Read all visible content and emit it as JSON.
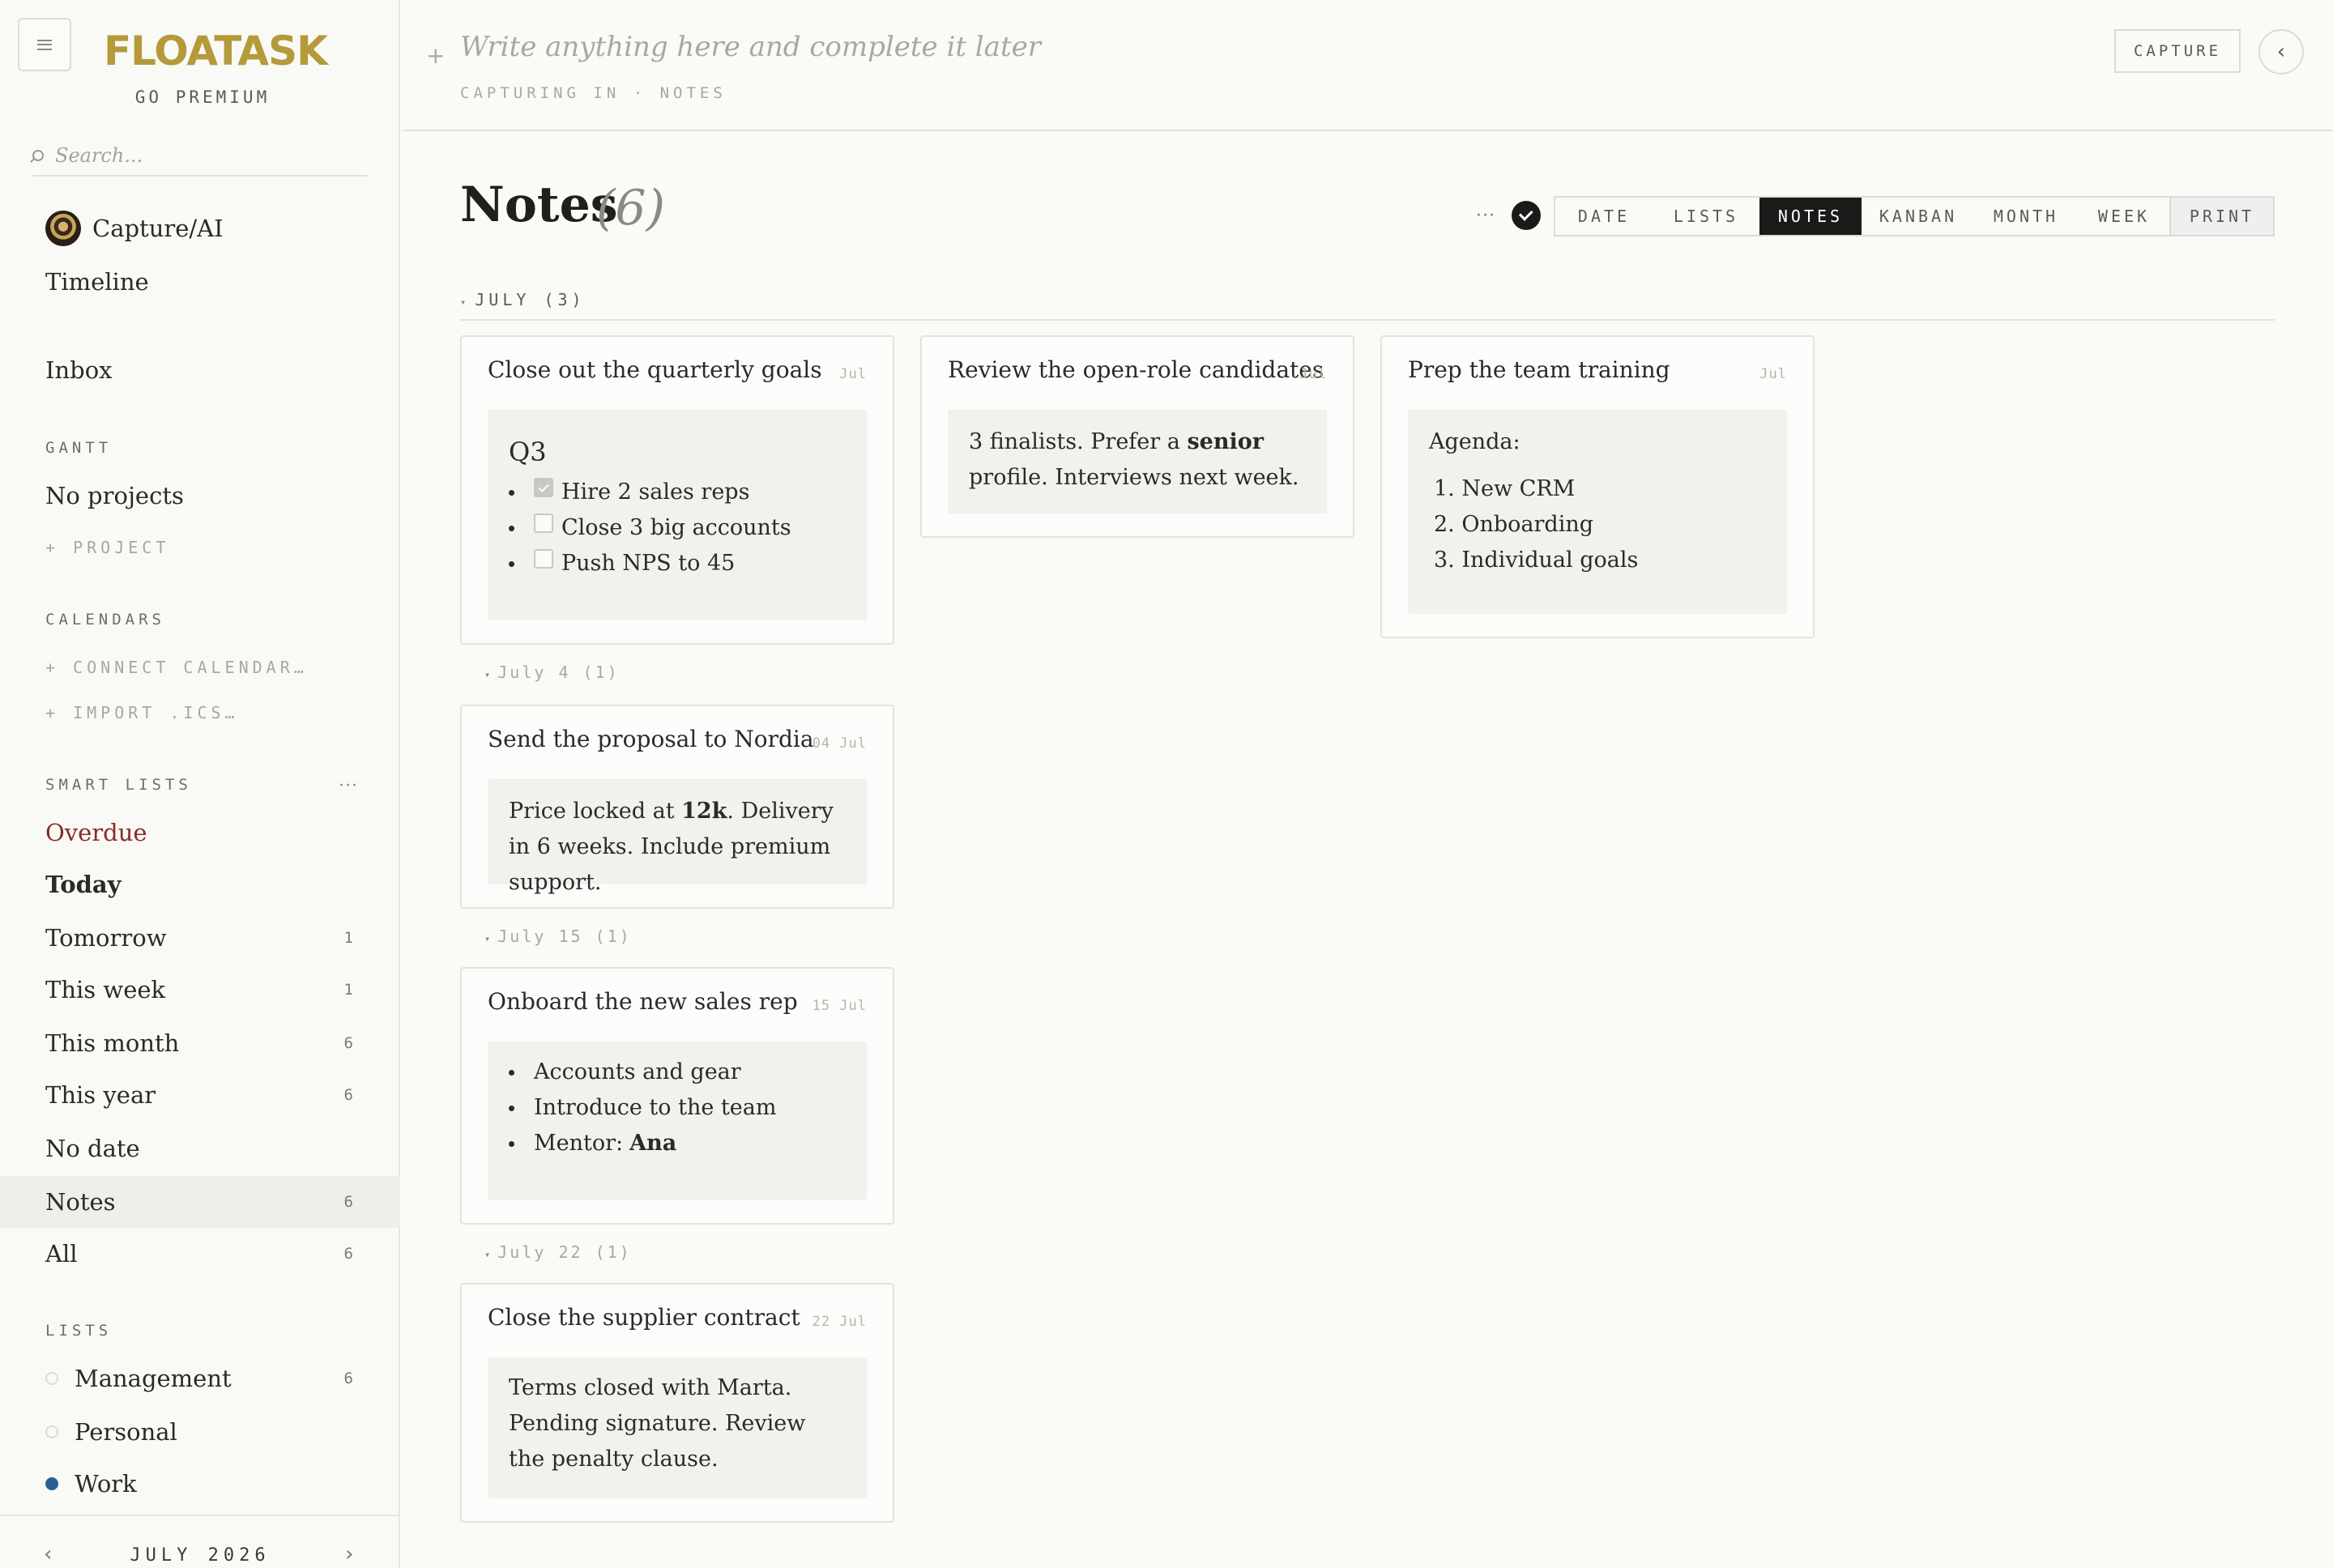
{
  "app": {
    "logo": "FLOATASK",
    "premium": "GO PREMIUM"
  },
  "sidebar": {
    "search_placeholder": "Search...",
    "top": [
      "Capture/AI",
      "Timeline",
      "Inbox"
    ],
    "gantt": {
      "heading": "GANTT",
      "empty": "No projects",
      "add": "+ PROJECT"
    },
    "calendars": {
      "heading": "CALENDARS",
      "connect": "+ CONNECT CALENDAR…",
      "import": "+ IMPORT .ICS…"
    },
    "smart_lists": {
      "heading": "SMART LISTS",
      "more": "···",
      "items": [
        {
          "label": "Overdue",
          "count": ""
        },
        {
          "label": "Today",
          "count": ""
        },
        {
          "label": "Tomorrow",
          "count": "1"
        },
        {
          "label": "This week",
          "count": "1"
        },
        {
          "label": "This month",
          "count": "6"
        },
        {
          "label": "This year",
          "count": "6"
        },
        {
          "label": "No date",
          "count": ""
        },
        {
          "label": "Notes",
          "count": "6"
        },
        {
          "label": "All",
          "count": "6"
        }
      ]
    },
    "lists": {
      "heading": "LISTS",
      "items": [
        {
          "label": "Management",
          "count": "6"
        },
        {
          "label": "Personal",
          "count": ""
        },
        {
          "label": "Work",
          "count": ""
        }
      ]
    },
    "calendar_footer": {
      "month": "JULY 2026",
      "prev": "‹",
      "next": "›"
    }
  },
  "capture": {
    "plus": "+",
    "placeholder": "Write anything here and complete it later",
    "sub": "CAPTURING IN · NOTES",
    "button": "CAPTURE",
    "collapse": "‹"
  },
  "main": {
    "title": "Notes",
    "count": "(6)",
    "more": "···",
    "view_tabs": [
      "DATE",
      "LISTS",
      "NOTES",
      "KANBAN",
      "MONTH",
      "WEEK"
    ],
    "active_view": "NOTES",
    "print": "PRINT",
    "group": {
      "caret": "▾",
      "label": "JULY (3)"
    },
    "subgroups": [
      {
        "caret": "▾",
        "label": "July 4 (1)"
      },
      {
        "caret": "▾",
        "label": "July 15 (1)"
      },
      {
        "caret": "▾",
        "label": "July 22 (1)"
      }
    ],
    "cards": [
      {
        "title": "Close out the quarterly goals",
        "date": "Jul",
        "heading": "Q3",
        "checklist": [
          {
            "text": "Hire 2 sales reps",
            "checked": true
          },
          {
            "text": "Close 3 big accounts",
            "checked": false
          },
          {
            "text": "Push NPS to 45",
            "checked": false
          }
        ]
      },
      {
        "title": "Review the open-role candidates",
        "date": "Jul",
        "text_a": "3 finalists. Prefer a ",
        "bold": "senior",
        "text_b": " profile. Interviews next week."
      },
      {
        "title": "Prep the team training",
        "date": "Jul",
        "intro": "Agenda:",
        "ordered": [
          "1. New CRM",
          "2. Onboarding",
          "3. Individual goals"
        ]
      },
      {
        "title": "Send the proposal to Nordia",
        "date": "04 Jul",
        "text_a": "Price locked at ",
        "bold": "12k",
        "text_b": ". Delivery in 6 weeks. Include premium support."
      },
      {
        "title": "Onboard the new sales rep",
        "date": "15 Jul",
        "bullets": [
          "Accounts and gear",
          "Introduce to the team"
        ],
        "mentor_label": "Mentor: ",
        "mentor_name": "Ana"
      },
      {
        "title": "Close the supplier contract",
        "date": "22 Jul",
        "text": "Terms closed with Marta. Pending signature. Review the penalty clause."
      }
    ]
  },
  "colors": {
    "accent_logo": "#b49a3a",
    "overdue": "#8a2a2a",
    "work_dot": "#2e5f92",
    "active_tab": "#1a1a18"
  }
}
